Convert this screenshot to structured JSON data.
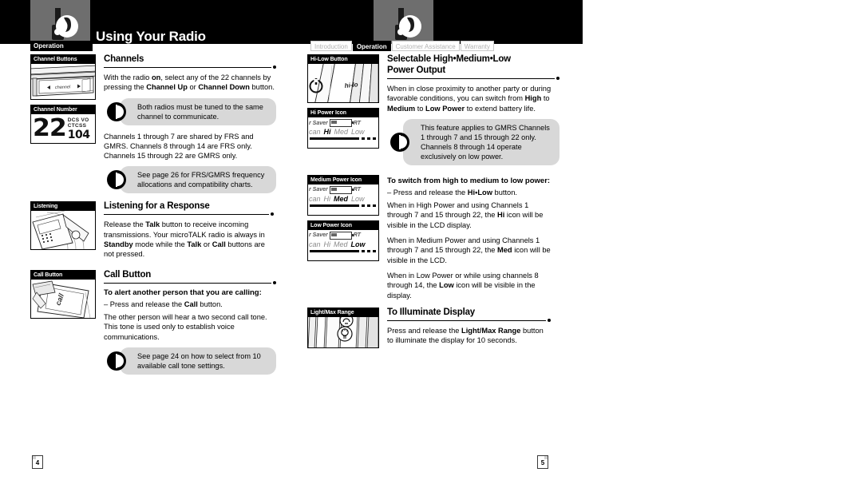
{
  "header": {
    "title": "Using Your Radio",
    "section_tab": "Operation",
    "logo_icon": "walkie-talkie-icon"
  },
  "nav_tabs": [
    {
      "label": "Introduction",
      "active": false
    },
    {
      "label": "Operation",
      "active": true
    },
    {
      "label": "Customer Assistance",
      "active": false
    },
    {
      "label": "Warranty",
      "active": false
    }
  ],
  "page_numbers": {
    "left": "4",
    "right": "5"
  },
  "left_column": {
    "channels": {
      "figure1_caption": "Channel Buttons",
      "figure1_label": "channel",
      "figure2_caption": "Channel Number",
      "lcd_channel": "22",
      "lcd_dcs": "DCS VO",
      "lcd_ctcss": "CTCSS",
      "lcd_code": "104",
      "heading": "Channels",
      "para1_part1": "With the radio ",
      "para1_bold1": "on",
      "para1_part2": ", select any of the 22 channels by pressing the ",
      "para1_bold2": "Channel Up",
      "para1_part3": " or ",
      "para1_bold3": "Channel Down",
      "para1_part4": " button.",
      "note1": "Both radios must be tuned to the same channel to communicate.",
      "para2": "Channels 1 through 7 are shared by FRS and GMRS. Channels 8 through 14 are FRS only. Channels 15 through 22 are GMRS only.",
      "note2": "See page 26 for FRS/GMRS frequency allocations and compatibility charts."
    },
    "listening": {
      "figure_caption": "Listening",
      "heading": "Listening for a Response",
      "para_part1": "Release the ",
      "para_bold1": "Talk",
      "para_part2": " button to receive incoming transmissions. Your microTALK radio is always in ",
      "para_bold2": "Standby",
      "para_part3": " mode while the ",
      "para_bold3": "Talk",
      "para_part4": " or ",
      "para_bold4": "Call",
      "para_part5": " buttons are not pressed."
    },
    "call_button": {
      "figure_caption": "Call Button",
      "figure_label": "call",
      "heading": "Call Button",
      "subheading": "To alert another person that you are calling:",
      "para1_part1": "– Press and release the ",
      "para1_bold1": "Call",
      "para1_part2": " button.",
      "para2": "The other person will hear a two second call tone. This tone is used only to establish voice communications.",
      "note": "See page 24 on how to select from 10 available call tone settings."
    }
  },
  "right_column": {
    "power_output": {
      "figure1_caption": "Hi-Low Button",
      "figure1_label": "hi-lo",
      "figure2_caption": "Hi Power Icon",
      "heading_line1": "Selectable High•Medium•Low",
      "heading_line2": "Power Output",
      "para_part1": "When in close proximity to another party or during favorable conditions, you can switch from ",
      "para_bold1": "High",
      "para_part2": " to ",
      "para_bold2": "Medium",
      "para_part3": " to ",
      "para_bold3": "Low Power",
      "para_part4": " to extend battery life.",
      "note": "This feature applies to GMRS Channels 1 through 7 and 15 through 22 only. Channels 8 through 14 operate exclusively on low power."
    },
    "switch_power": {
      "figure1_caption": "Medium Power Icon",
      "figure2_caption": "Low Power Icon",
      "subheading": "To switch from high to medium to low power:",
      "para1_part1": "– Press and release the ",
      "para1_bold1": "Hi•Low",
      "para1_part2": " button.",
      "para2_part1": "When in High Power and using Channels 1 through 7 and 15 through 22, the ",
      "para2_bold1": "Hi",
      "para2_part2": " icon will be visible in the LCD display.",
      "para3_part1": "When in Medium Power and using Channels 1 through 7 and 15 through 22, the ",
      "para3_bold1": "Med",
      "para3_part2": " icon will be visible in the LCD.",
      "para4_part1": "When in Low Power or while using channels 8 through 14, the ",
      "para4_bold1": "Low",
      "para4_part2": " icon will be visible in the display."
    },
    "illuminate": {
      "figure_caption": "Light/Max Range",
      "heading": "To Illuminate Display",
      "para_part1": "Press and release the ",
      "para_bold1": "Light/Max Range",
      "para_part2": " button to illuminate the display for 10 seconds."
    },
    "lcd_labels": {
      "saver": "r Saver",
      "rt": "RT",
      "scan": "can",
      "hi": "Hi",
      "med": "Med",
      "low": "Low"
    }
  },
  "colors": {
    "black": "#000000",
    "note_bubble": "#d8d8d8",
    "logo_plate": "#6e6e6e",
    "tab_inactive_text": "#b3b3b3"
  }
}
